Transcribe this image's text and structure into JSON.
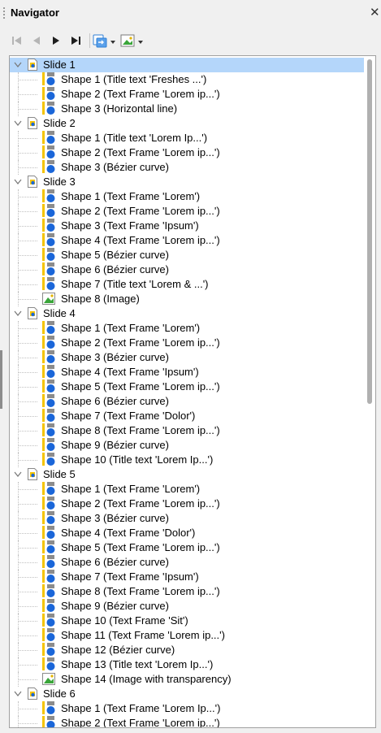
{
  "panel": {
    "title": "Navigator",
    "close_glyph": "✕"
  },
  "toolbar": {
    "buttons": [
      {
        "name": "first-slide-button",
        "icon": "first-icon",
        "enabled": false
      },
      {
        "name": "previous-slide-button",
        "icon": "previous-icon",
        "enabled": false
      },
      {
        "name": "next-slide-button",
        "icon": "next-icon",
        "enabled": true
      },
      {
        "name": "last-slide-button",
        "icon": "last-icon",
        "enabled": true
      },
      {
        "name": "drag-mode-button",
        "icon": "drag-mode-icon",
        "enabled": true
      },
      {
        "name": "show-shapes-button",
        "icon": "image-icon",
        "enabled": true
      }
    ]
  },
  "colors": {
    "selection": "#b4d6fa",
    "shape_bar": "#f5c400",
    "shape_circle": "#1a66d9",
    "shape_rect": "#8c8c8c",
    "image_green": "#3aa53a"
  },
  "tree": {
    "slides": [
      {
        "label": "Slide 1",
        "selected": true,
        "shapes": [
          {
            "label": "Shape 1 (Title text 'Freshes ...')",
            "kind": "shape"
          },
          {
            "label": "Shape 2 (Text Frame 'Lorem ip...')",
            "kind": "shape"
          },
          {
            "label": "Shape 3 (Horizontal line)",
            "kind": "shape"
          }
        ]
      },
      {
        "label": "Slide 2",
        "selected": false,
        "shapes": [
          {
            "label": "Shape 1 (Title text 'Lorem Ip...')",
            "kind": "shape"
          },
          {
            "label": "Shape 2 (Text Frame 'Lorem ip...')",
            "kind": "shape"
          },
          {
            "label": "Shape 3 (Bézier curve)",
            "kind": "shape"
          }
        ]
      },
      {
        "label": "Slide 3",
        "selected": false,
        "shapes": [
          {
            "label": "Shape 1 (Text Frame 'Lorem')",
            "kind": "shape"
          },
          {
            "label": "Shape 2 (Text Frame 'Lorem ip...')",
            "kind": "shape"
          },
          {
            "label": "Shape 3 (Text Frame 'Ipsum')",
            "kind": "shape"
          },
          {
            "label": "Shape 4 (Text Frame 'Lorem ip...')",
            "kind": "shape"
          },
          {
            "label": "Shape 5 (Bézier curve)",
            "kind": "shape"
          },
          {
            "label": "Shape 6 (Bézier curve)",
            "kind": "shape"
          },
          {
            "label": "Shape 7 (Title text 'Lorem & ...')",
            "kind": "shape"
          },
          {
            "label": "Shape 8 (Image)",
            "kind": "image"
          }
        ]
      },
      {
        "label": "Slide 4",
        "selected": false,
        "shapes": [
          {
            "label": "Shape 1 (Text Frame 'Lorem')",
            "kind": "shape"
          },
          {
            "label": "Shape 2 (Text Frame 'Lorem ip...')",
            "kind": "shape"
          },
          {
            "label": "Shape 3 (Bézier curve)",
            "kind": "shape"
          },
          {
            "label": "Shape 4 (Text Frame 'Ipsum')",
            "kind": "shape"
          },
          {
            "label": "Shape 5 (Text Frame 'Lorem ip...')",
            "kind": "shape"
          },
          {
            "label": "Shape 6 (Bézier curve)",
            "kind": "shape"
          },
          {
            "label": "Shape 7 (Text Frame 'Dolor')",
            "kind": "shape"
          },
          {
            "label": "Shape 8 (Text Frame 'Lorem ip...')",
            "kind": "shape"
          },
          {
            "label": "Shape 9 (Bézier curve)",
            "kind": "shape"
          },
          {
            "label": "Shape 10 (Title text 'Lorem Ip...')",
            "kind": "shape"
          }
        ]
      },
      {
        "label": "Slide 5",
        "selected": false,
        "shapes": [
          {
            "label": "Shape 1 (Text Frame 'Lorem')",
            "kind": "shape"
          },
          {
            "label": "Shape 2 (Text Frame 'Lorem ip...')",
            "kind": "shape"
          },
          {
            "label": "Shape 3 (Bézier curve)",
            "kind": "shape"
          },
          {
            "label": "Shape 4 (Text Frame 'Dolor')",
            "kind": "shape"
          },
          {
            "label": "Shape 5 (Text Frame 'Lorem ip...')",
            "kind": "shape"
          },
          {
            "label": "Shape 6 (Bézier curve)",
            "kind": "shape"
          },
          {
            "label": "Shape 7 (Text Frame 'Ipsum')",
            "kind": "shape"
          },
          {
            "label": "Shape 8 (Text Frame 'Lorem ip...')",
            "kind": "shape"
          },
          {
            "label": "Shape 9 (Bézier curve)",
            "kind": "shape"
          },
          {
            "label": "Shape 10 (Text Frame 'Sit')",
            "kind": "shape"
          },
          {
            "label": "Shape 11 (Text Frame 'Lorem ip...')",
            "kind": "shape"
          },
          {
            "label": "Shape 12 (Bézier curve)",
            "kind": "shape"
          },
          {
            "label": "Shape 13 (Title text 'Lorem Ip...')",
            "kind": "shape"
          },
          {
            "label": "Shape 14 (Image with transparency)",
            "kind": "image"
          }
        ]
      },
      {
        "label": "Slide 6",
        "selected": false,
        "shapes": [
          {
            "label": "Shape 1 (Text Frame 'Lorem Ip...')",
            "kind": "shape"
          },
          {
            "label": "Shape 2 (Text Frame 'Lorem ip...')",
            "kind": "shape"
          }
        ]
      }
    ]
  }
}
